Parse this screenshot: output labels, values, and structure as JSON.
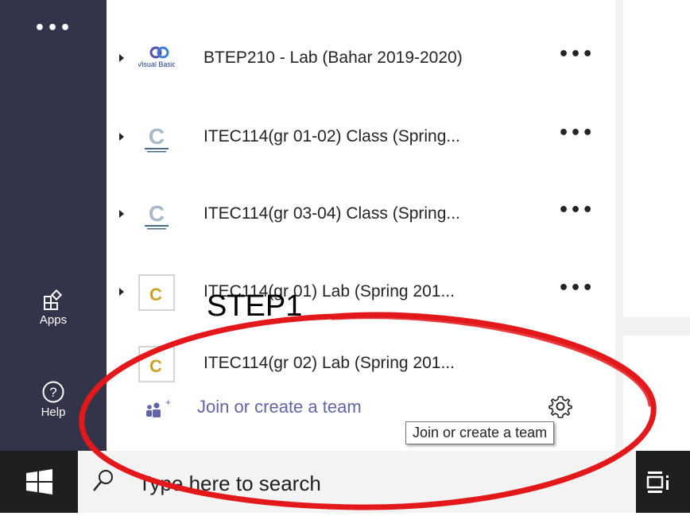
{
  "rail": {
    "more_label": "•••",
    "apps_label": "Apps",
    "help_label": "Help"
  },
  "teams": [
    {
      "name": "BTEP210 - Lab (Bahar 2019-2020)",
      "logo": "visual-basic-logo",
      "logo_text": "Visual Basic"
    },
    {
      "name": "ITEC114(gr 01-02) Class (Spring...",
      "logo": "c-language-logo",
      "logo_text": "C"
    },
    {
      "name": "ITEC114(gr 03-04) Class (Spring...",
      "logo": "c-language-logo",
      "logo_text": "C"
    },
    {
      "name": "ITEC114(gr 01) Lab (Spring 201...",
      "logo": "c-tile-logo",
      "logo_text": "C"
    },
    {
      "name": "ITEC114(gr 02) Lab (Spring 201...",
      "logo": "c-tile-logo",
      "logo_text": "C"
    }
  ],
  "row_more_label": "•••",
  "annotation_label": "STEP1",
  "join": {
    "label": "Join or create a team",
    "tooltip": "Join or create a team"
  },
  "taskbar": {
    "search_placeholder": "Type here to search"
  },
  "colors": {
    "rail": "#33344a",
    "accent": "#6264a7",
    "annotation": "#e3181b",
    "taskbar": "#1f1f1f"
  }
}
